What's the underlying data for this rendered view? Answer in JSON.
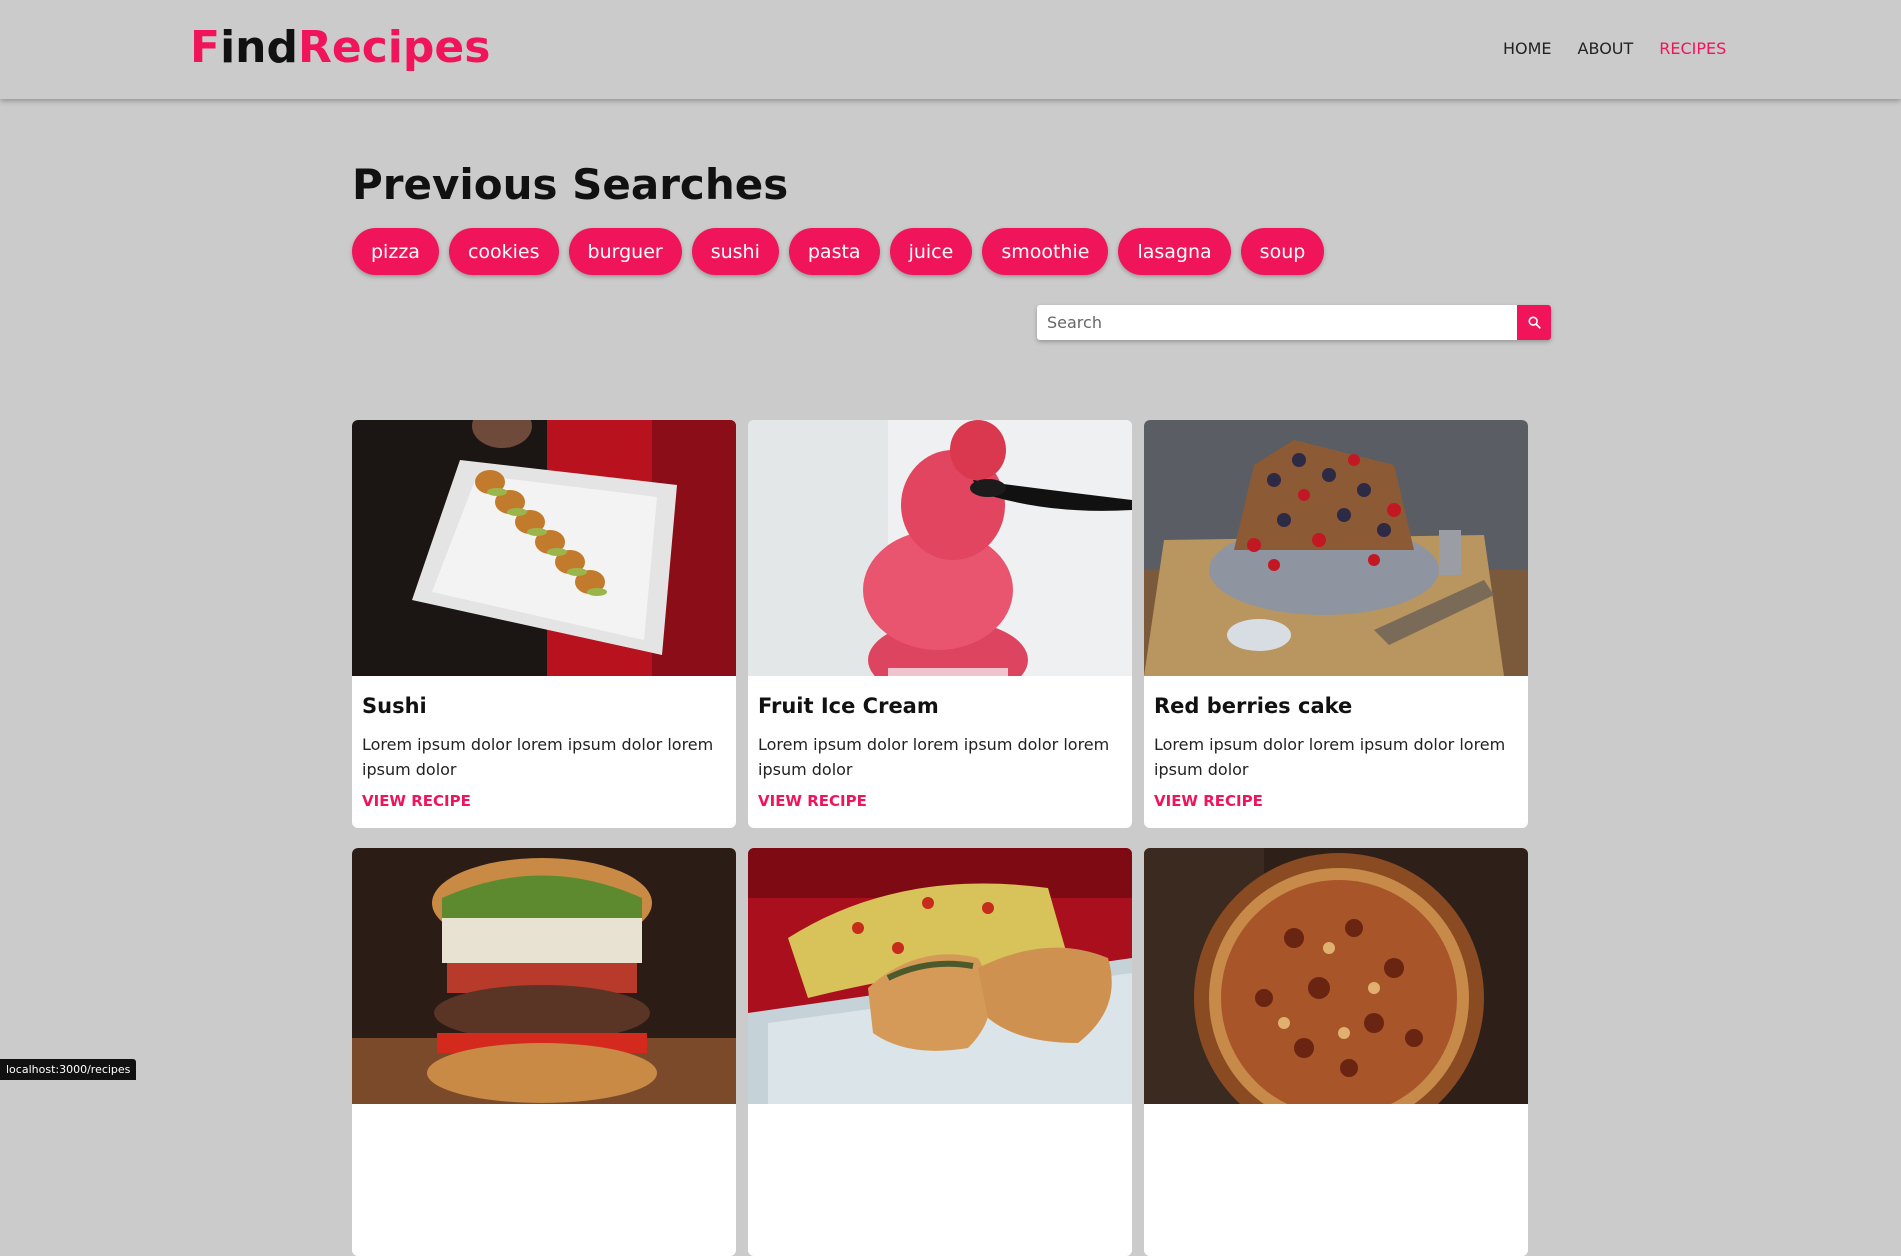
{
  "app": {
    "logo": {
      "part1": "F",
      "part2": "ind",
      "part3": "Recipes"
    }
  },
  "nav": {
    "items": [
      {
        "label": "HOME"
      },
      {
        "label": "ABOUT"
      },
      {
        "label": "RECIPES"
      }
    ],
    "active": "RECIPES",
    "accent_color": "#f0145a"
  },
  "previous_searches": {
    "title": "Previous Searches",
    "items": [
      "pizza",
      "cookies",
      "burguer",
      "sushi",
      "pasta",
      "juice",
      "smoothie",
      "lasagna",
      "soup"
    ]
  },
  "search": {
    "placeholder": "Search",
    "value": "",
    "icon": "search-icon"
  },
  "recipes": [
    {
      "title": "Sushi",
      "description": "Lorem ipsum dolor lorem ipsum dolor lorem ipsum dolor",
      "link": "VIEW RECIPE",
      "image": "sushi-plate-photo"
    },
    {
      "title": "Fruit Ice Cream",
      "description": "Lorem ipsum dolor lorem ipsum dolor lorem ipsum dolor",
      "link": "VIEW RECIPE",
      "image": "pink-ice-cream-photo"
    },
    {
      "title": "Red berries cake",
      "description": "Lorem ipsum dolor lorem ipsum dolor lorem ipsum dolor",
      "link": "VIEW RECIPE",
      "image": "berry-cake-photo"
    },
    {
      "title": "",
      "description": "",
      "link": "",
      "image": "burger-photo"
    },
    {
      "title": "",
      "description": "",
      "link": "",
      "image": "grilled-fish-photo"
    },
    {
      "title": "",
      "description": "",
      "link": "",
      "image": "pizza-photo"
    }
  ],
  "status_bar": {
    "url": "localhost:3000/recipes"
  }
}
